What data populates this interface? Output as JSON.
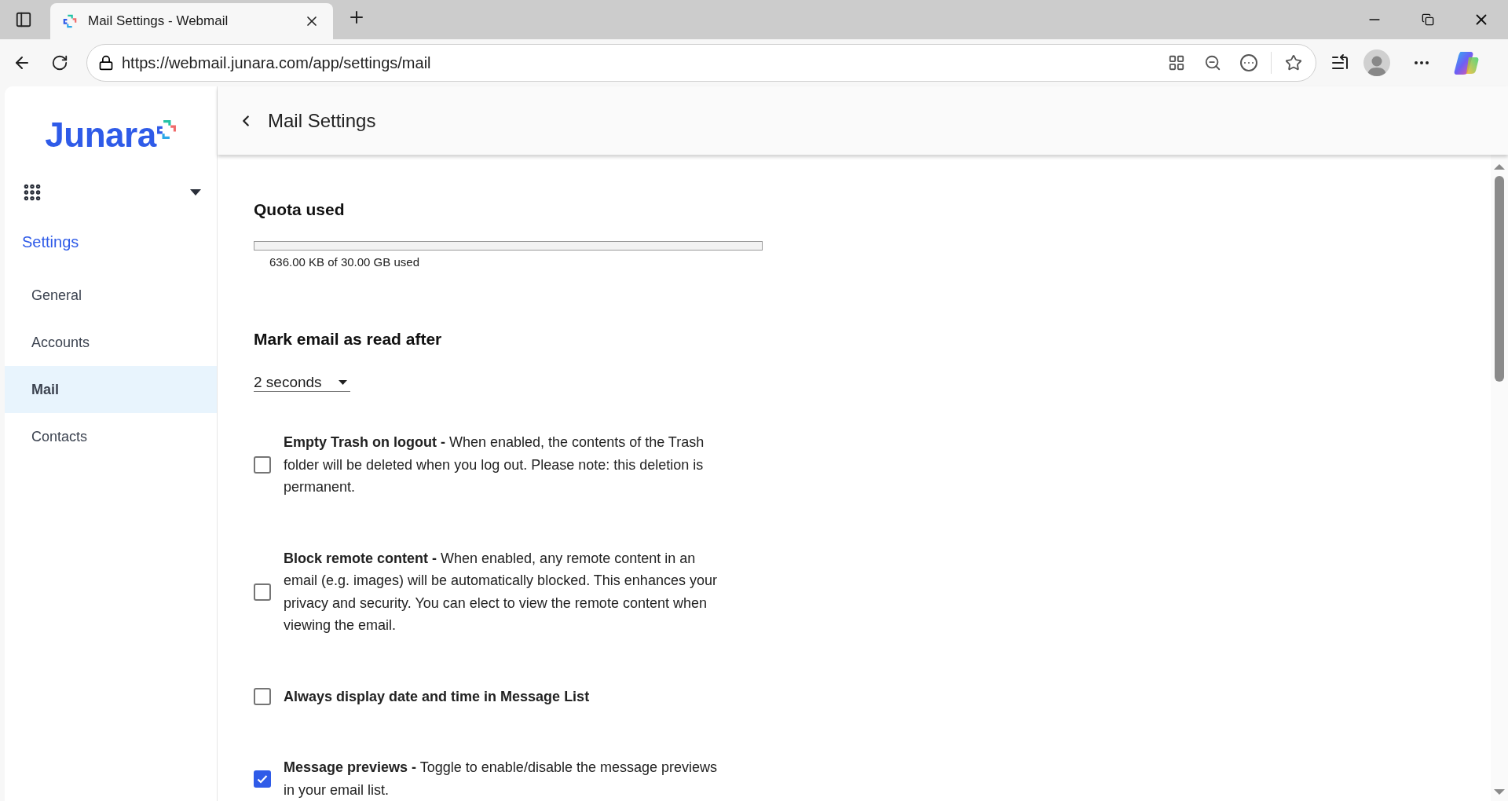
{
  "browser": {
    "tab_title": "Mail Settings - Webmail",
    "url": "https://webmail.junara.com/app/settings/mail"
  },
  "sidebar": {
    "logo": "Junara",
    "section": "Settings",
    "items": [
      {
        "label": "General",
        "selected": false
      },
      {
        "label": "Accounts",
        "selected": false
      },
      {
        "label": "Mail",
        "selected": true
      },
      {
        "label": "Contacts",
        "selected": false
      }
    ]
  },
  "header": {
    "title": "Mail Settings"
  },
  "quota": {
    "heading": "Quota used",
    "level": 0,
    "reading": "636.00 KB of 30.00 GB used"
  },
  "mark_read": {
    "heading": "Mark email as read after",
    "value": "2 seconds"
  },
  "options": [
    {
      "kind": "detailed",
      "text": "**Empty Trash on logout -** When enabled, the contents of the Trash folder will be deleted when you log out. Please note: this deletion is permanent.",
      "checked": false
    },
    {
      "kind": "detailed",
      "text": "**Block remote content -** When enabled, any remote content in an email (e.g. images) will be automatically blocked. This enhances your privacy and security. You can elect to view the remote content when viewing the email.",
      "checked": false
    },
    {
      "kind": "title",
      "text": "Always display date and time in Message List",
      "checked": false
    },
    {
      "kind": "detailed",
      "text": "**Message previews -** Toggle to enable/disable the message previews in your email list.",
      "checked": true
    }
  ]
}
